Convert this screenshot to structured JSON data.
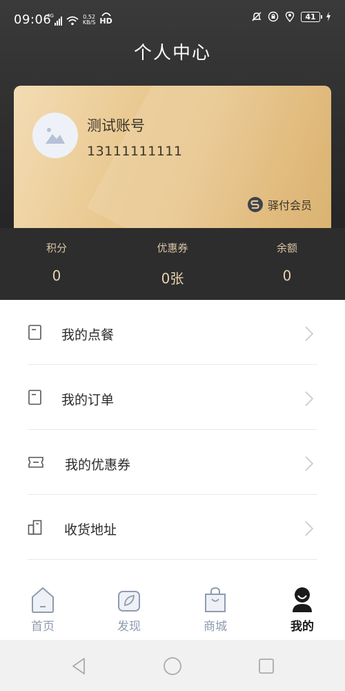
{
  "status_bar": {
    "time": "09:06",
    "network": "4G",
    "speed_value": "0.52",
    "speed_unit": "KB/S",
    "hd": "HD",
    "battery": "41"
  },
  "header": {
    "title": "个人中心"
  },
  "card": {
    "user_name": "测试账号",
    "phone": "13111111111",
    "brand": "驿付会员"
  },
  "stats": [
    {
      "label": "积分",
      "value": "0"
    },
    {
      "label": "优惠券",
      "value": "0张"
    },
    {
      "label": "余额",
      "value": "0"
    }
  ],
  "menu": [
    {
      "label": "我的点餐",
      "icon": "document-icon"
    },
    {
      "label": "我的订单",
      "icon": "document-icon"
    },
    {
      "label": "我的优惠券",
      "icon": "ticket-icon"
    },
    {
      "label": "收货地址",
      "icon": "building-icon"
    }
  ],
  "tabs": [
    {
      "label": "首页",
      "icon": "home-icon",
      "active": false
    },
    {
      "label": "发现",
      "icon": "leaf-icon",
      "active": false
    },
    {
      "label": "商城",
      "icon": "shopping-bag-icon",
      "active": false
    },
    {
      "label": "我的",
      "icon": "profile-icon",
      "active": true
    }
  ],
  "colors": {
    "header_dark": "#2b2b2b",
    "card_gold": "#e8c58b",
    "stat_text": "#e6d2b0",
    "tab_inactive": "#8f9bb0",
    "tab_active": "#1a1a1a"
  }
}
